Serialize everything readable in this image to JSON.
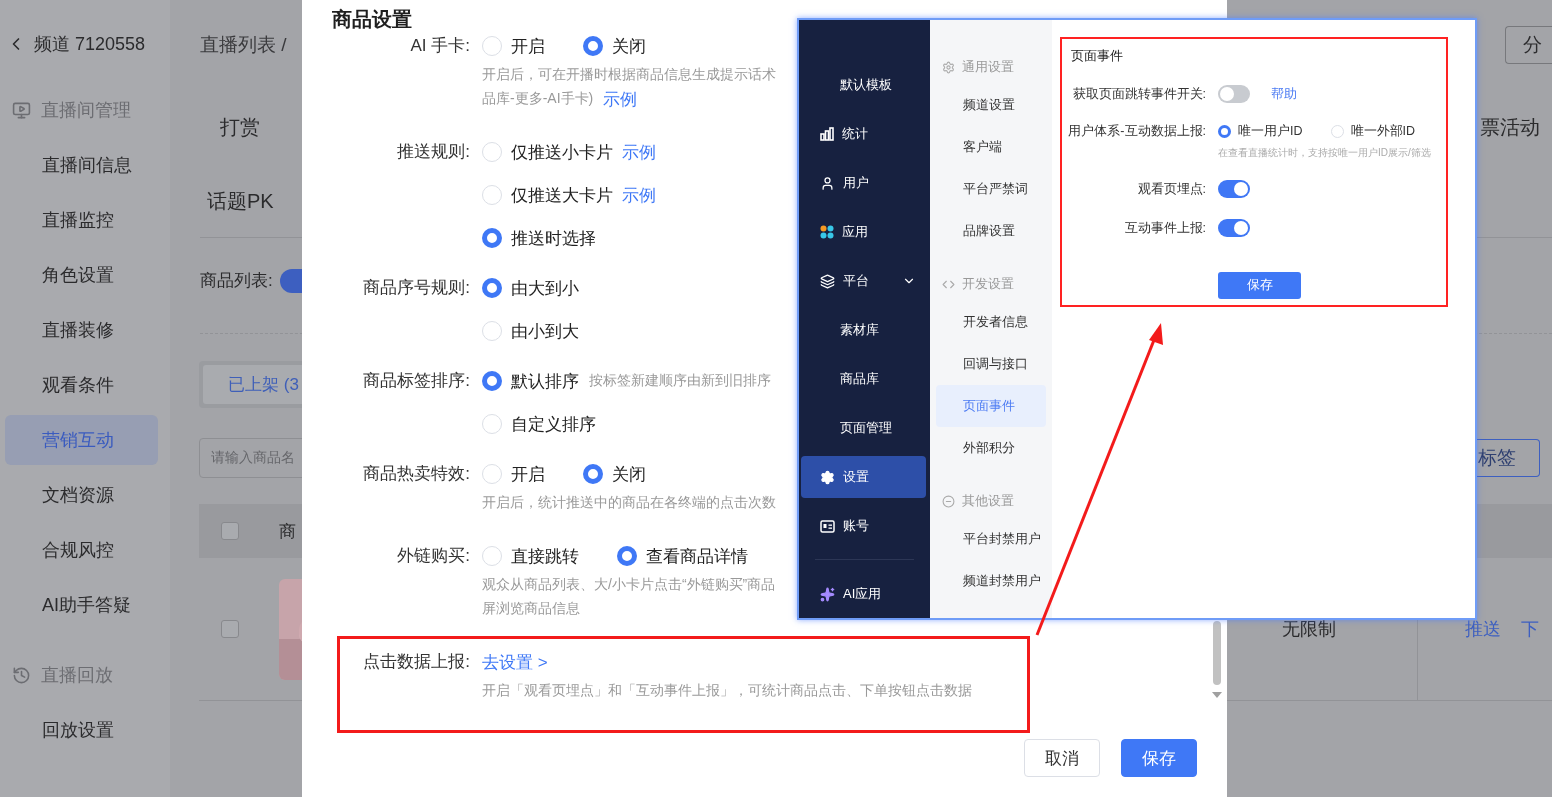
{
  "sidebar": {
    "back_label": "频道 7120558",
    "sections": [
      {
        "title": "直播间管理",
        "items": [
          {
            "label": "直播间信息",
            "selected": false
          },
          {
            "label": "直播监控",
            "selected": false
          },
          {
            "label": "角色设置",
            "selected": false
          },
          {
            "label": "直播装修",
            "selected": false
          },
          {
            "label": "观看条件",
            "selected": false
          },
          {
            "label": "营销互动",
            "selected": true
          },
          {
            "label": "文档资源",
            "selected": false
          },
          {
            "label": "合规风控",
            "selected": false
          },
          {
            "label": "AI助手答疑",
            "selected": false
          }
        ]
      },
      {
        "title": "直播回放",
        "items": [
          {
            "label": "回放设置",
            "selected": false
          }
        ]
      }
    ]
  },
  "main": {
    "breadcrumb": "直播列表 /",
    "share_button": "分",
    "tabs": [
      {
        "label": "打赏"
      },
      {
        "label": "话题PK"
      }
    ],
    "right_tab": "票活动",
    "goods_list_label": "商品列表:",
    "goods_list_switch": {
      "on": true
    },
    "status_tabs": [
      {
        "label": "已上架 (3",
        "selected": true
      }
    ],
    "search": {
      "placeholder": "请输入商品名"
    },
    "tag_button": "标签",
    "table": {
      "header": {
        "column_2": "商",
        "checked": false
      },
      "rows": [
        {
          "checked": false,
          "picture": {
            "kind": "picture"
          },
          "column_4": "无限制",
          "actions": [
            "推送",
            "下"
          ]
        }
      ]
    }
  },
  "modal": {
    "title": "商品设置",
    "rows": [
      {
        "label": "AI 手卡:",
        "kind": "radio",
        "options": [
          {
            "label": "开启",
            "selected": false
          },
          {
            "label": "关闭",
            "selected": true
          }
        ],
        "hint": [
          "开启后，可在开播时根据商品信息生成提示话术",
          "品库-更多-AI手卡)"
        ],
        "hint_link": "示例"
      },
      {
        "label": "推送规则:",
        "kind": "radio_list",
        "options": [
          {
            "label": "仅推送小卡片",
            "selected": false,
            "link": "示例"
          },
          {
            "label": "仅推送大卡片",
            "selected": false,
            "link": "示例"
          },
          {
            "label": "推送时选择",
            "selected": true
          }
        ]
      },
      {
        "label": "商品序号规则:",
        "kind": "radio_list",
        "options": [
          {
            "label": "由大到小",
            "selected": true
          },
          {
            "label": "由小到大",
            "selected": false
          }
        ]
      },
      {
        "label": "商品标签排序:",
        "kind": "radio_list",
        "options": [
          {
            "label": "默认排序",
            "selected": true,
            "note": "按标签新建顺序由新到旧排序"
          },
          {
            "label": "自定义排序",
            "selected": false
          }
        ]
      },
      {
        "label": "商品热卖特效:",
        "kind": "radio",
        "options": [
          {
            "label": "开启",
            "selected": false
          },
          {
            "label": "关闭",
            "selected": true
          }
        ],
        "hint": [
          "开启后，统计推送中的商品在各终端的点击次数"
        ]
      },
      {
        "label": "外链购买:",
        "kind": "radio",
        "options": [
          {
            "label": "直接跳转",
            "selected": false
          },
          {
            "label": "查看商品详情",
            "selected": true
          }
        ],
        "hint": [
          "观众从商品列表、大/小卡片点击“外链购买”商品",
          "屏浏览商品信息"
        ]
      },
      {
        "label": "点击数据上报:",
        "kind": "link",
        "link": "去设置 >",
        "hint": [
          "开启「观看页埋点」和「互动事件上报」，可统计商品点击、下单按钮点击数据"
        ],
        "highlighted": true
      }
    ],
    "buttons": [
      {
        "label": "取消",
        "primary": false
      },
      {
        "label": "保存",
        "primary": true
      }
    ]
  },
  "inset": {
    "nav": [
      {
        "label": "默认模板",
        "kind": "sub",
        "selected": false
      },
      {
        "label": "统计",
        "kind": "main",
        "selected": false
      },
      {
        "label": "用户",
        "kind": "main",
        "selected": false
      },
      {
        "label": "应用",
        "kind": "main",
        "selected": false
      },
      {
        "label": "平台",
        "kind": "group",
        "expanded": true,
        "selected": false
      },
      {
        "label": "素材库",
        "kind": "sub",
        "selected": false
      },
      {
        "label": "商品库",
        "kind": "sub",
        "selected": false
      },
      {
        "label": "页面管理",
        "kind": "sub",
        "selected": false
      },
      {
        "label": "设置",
        "kind": "main",
        "selected": true
      },
      {
        "label": "账号",
        "kind": "main",
        "selected": false
      },
      {
        "label": "AI应用",
        "kind": "footer",
        "selected": false
      }
    ],
    "subnav": [
      {
        "title": "通用设置",
        "items": [
          {
            "label": "频道设置",
            "selected": false
          },
          {
            "label": "客户端",
            "selected": false
          },
          {
            "label": "平台严禁词",
            "selected": false
          },
          {
            "label": "品牌设置",
            "selected": false
          }
        ]
      },
      {
        "title": "开发设置",
        "items": [
          {
            "label": "开发者信息",
            "selected": false
          },
          {
            "label": "回调与接口",
            "selected": false
          },
          {
            "label": "页面事件",
            "selected": true
          },
          {
            "label": "外部积分",
            "selected": false
          }
        ]
      },
      {
        "title": "其他设置",
        "items": [
          {
            "label": "平台封禁用户",
            "selected": false
          },
          {
            "label": "频道封禁用户",
            "selected": false
          }
        ]
      }
    ],
    "panel": {
      "title": "页面事件",
      "highlighted": true,
      "rows": [
        {
          "kind": "switch",
          "label": "获取页面跳转事件开关:",
          "on": false,
          "link": "帮助"
        },
        {
          "kind": "radio",
          "label": "用户体系-互动数据上报:",
          "options": [
            {
              "label": "唯一用户ID",
              "selected": true
            },
            {
              "label": "唯一外部ID",
              "selected": false
            }
          ],
          "hint": "在查看直播统计时，支持按唯一用户ID展示/筛选"
        },
        {
          "kind": "switch",
          "label": "观看页埋点:",
          "on": true
        },
        {
          "kind": "switch",
          "label": "互动事件上报:",
          "on": true
        }
      ],
      "button": "保存"
    }
  }
}
